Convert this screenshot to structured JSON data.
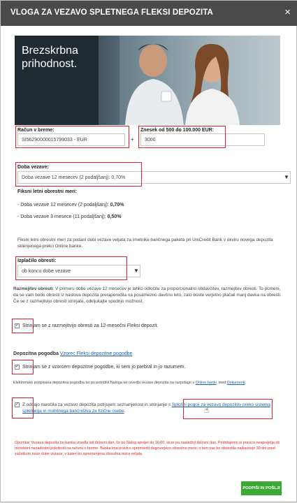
{
  "dialog": {
    "title": "VLOGA ZA VEZAVO SPLETNEGA FLEKSI DEPOZITA",
    "close_icon": "×"
  },
  "banner": {
    "text": "Brezskrbna\nprihodnost."
  },
  "account": {
    "label": "Račun v breme:",
    "value": "SI56290000015799033 - EUR"
  },
  "plus_sign": "+",
  "amount": {
    "label": "Znesek od 500 do 100.000 EUR:",
    "value": "3000"
  },
  "term": {
    "label": "Doba vezave:",
    "selected": "Doba vezave 12 mesecev (2 podaljšanj): 0,70%",
    "arrow": "▼"
  },
  "rates": {
    "heading": "Fiksni letni obrestni meri:",
    "items": [
      {
        "text": "- Doba vezave 12 mesecev (2 podaljšanj): ",
        "rate": "0,70%"
      },
      {
        "text": "- Doba vezave  3 mesece (11 podaljšanj): ",
        "rate": "0,50%"
      }
    ]
  },
  "rate_info": "Fiksni letni obrestni meri za podani dobi vezave veljata za imetnike bančnega paketa pri UniCredit Bank v okviru novega depozita sklenjenega preko Online banke.",
  "payout": {
    "label": "Izplačilo obresti:",
    "selected": "ob koncu dobe vezave",
    "arrow": "▼"
  },
  "interest_split": {
    "heading": "Razmejitev obresti",
    "text": ": V primeru dobe vezave 12 mesecev je lahko odločite za proporcionalno obdavčitev, razmejitev obresti. To pomeni, da se vam bodo obresti iz naslova depozita preraporedila na posamezno davčno leto, zato boste verjetno plačali manj davka na obresti. Če se z razmejitvijo obresti strinjate, odkljukajte spodnjo možnost.",
    "checkbox_label": "Strinjam se z razmejitvijo obresti za 12-mesečni Fleksi depozit."
  },
  "contract": {
    "heading": "Depozitna pogodba",
    "link": "Vzorec Fleksi depozitne pogodbe",
    "checkbox_label": "Strinjam se z vzorcem depozitne pogodbe, ki sem jo prebral in jo razumem.",
    "signed_note": "Elektronsko podpisana depozitna pogodba bo po potrditvi Naloga ter izvedbi vezave depozita na razpolago v ",
    "signed_link1": "Online banki",
    "signed_mid": ", med ",
    "signed_link2": "Dokumenti",
    "signed_end": "."
  },
  "terms": {
    "text": "Z oddajo naročila za vezavo depozita potrjujem seznanjenost in strinjanje s ",
    "link": "Splošni pogoji za vezavo depozitov preko sistema spletnega in mobilnega bančništva za fizične osebe",
    "end": "."
  },
  "note": "Opomba: Vezava depozita bo banka izvedla isti delovni dan, če bo Nalog sprejet do 16:00, sicer pa naslednji delovni dan. Pridržujemo si pravico nesprejetja ob morebitni nezadostni pokritosti na računu v breme. Banka ima pravico spremeniti dogovorjeno obrestno mero; o tem vas bo obvestila najkasneje 30 dni pred začetkom nove dobe vezave, v kateri bo spremenjena obrestna mera veljala.",
  "submit": {
    "label": "PODPIŠI IN POŠLJI"
  },
  "colors": {
    "header": "#4a4a4a",
    "highlight": "#e0202e",
    "submit": "#3aaa35",
    "link": "#1f5fb0"
  }
}
